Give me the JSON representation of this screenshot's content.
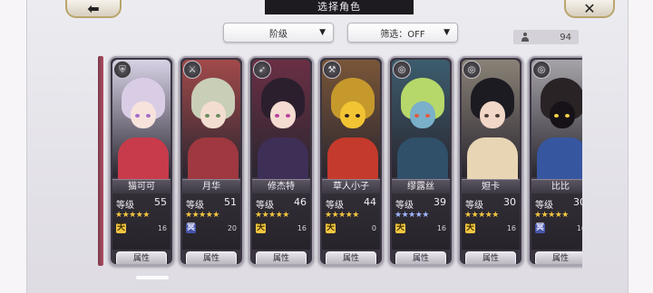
{
  "header": {
    "title": "选择角色",
    "back_icon": "arrow-left-icon",
    "close_icon": "close-icon"
  },
  "filters": {
    "sort": {
      "label": "阶级",
      "caret": "▼"
    },
    "filter": {
      "label": "筛选：OFF",
      "caret": "▼"
    }
  },
  "roster_count": "94",
  "level_label": "等级",
  "attr_label": "属性",
  "cards": [
    {
      "name": "猫可可",
      "level": "55",
      "stars": "★★★★★",
      "star_color": "gold",
      "element": "天",
      "sub": "16",
      "weapon": "shield-icon",
      "hair": "#d9cde6",
      "skin": "#f7e3dc",
      "outfit": "#c83b4b",
      "bg": "#d8d2e6",
      "eye": "#a56acb"
    },
    {
      "name": "月华",
      "level": "51",
      "stars": "★★★★★",
      "star_color": "gold",
      "element": "冥",
      "sub": "20",
      "weapon": "sword-icon",
      "hair": "#c9cfb7",
      "skin": "#f3ddd1",
      "outfit": "#9f3840",
      "bg": "#a24a4a",
      "eye": "#6b8c5c"
    },
    {
      "name": "修杰特",
      "level": "46",
      "stars": "★★★★★",
      "star_color": "gold",
      "element": "天",
      "sub": "16",
      "weapon": "spear-icon",
      "hair": "#2b1f2e",
      "skin": "#f4dcd2",
      "outfit": "#3e2f56",
      "bg": "#6b2f44",
      "eye": "#b83fa0"
    },
    {
      "name": "草人小子",
      "level": "44",
      "stars": "★★★★★",
      "star_color": "gold",
      "element": "天",
      "sub": "0",
      "weapon": "axe-icon",
      "hair": "#c6992c",
      "skin": "#f2c433",
      "outfit": "#c43a2c",
      "bg": "#7a5638",
      "eye": "#2a2020"
    },
    {
      "name": "缪露丝",
      "level": "39",
      "stars": "★★★★★",
      "star_color": "blue",
      "element": "天",
      "sub": "16",
      "weapon": "whip-icon",
      "hair": "#b6d86a",
      "skin": "#7ab0c9",
      "outfit": "#2f5068",
      "bg": "#3c5d6e",
      "eye": "#e25c3c"
    },
    {
      "name": "妲卡",
      "level": "30",
      "stars": "★★★★★",
      "star_color": "gold",
      "element": "天",
      "sub": "16",
      "weapon": "whip-icon",
      "hair": "#1d1b22",
      "skin": "#f1d7c8",
      "outfit": "#e8d5b4",
      "bg": "#8a8276",
      "eye": "#4a3a32"
    },
    {
      "name": "比比",
      "level": "30",
      "stars": "★★★★★",
      "star_color": "gold",
      "element": "冥",
      "sub": "16",
      "weapon": "whip-icon",
      "hair": "#2a2326",
      "skin": "#161217",
      "outfit": "#3657a0",
      "bg": "#a6a3a8",
      "eye": "#f5d14a"
    }
  ],
  "colors": {
    "star_gold": "#f2c740",
    "star_blue": "#9fb6ff",
    "element_heaven_bg": "#f2c740",
    "element_heaven_fg": "#3a2b00",
    "element_nether_bg": "#4654a8",
    "element_nether_fg": "#e8ebff"
  }
}
